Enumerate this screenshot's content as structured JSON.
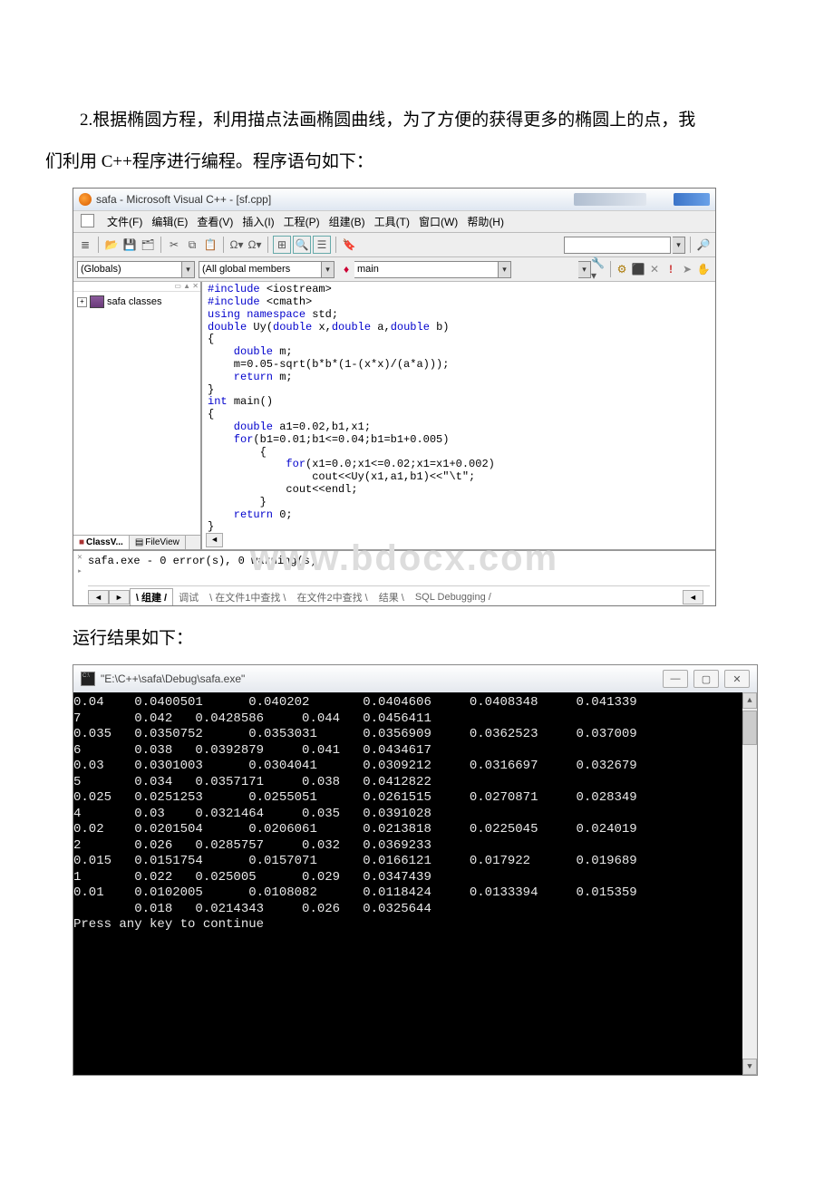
{
  "intro": {
    "line1": "2.根据椭圆方程，利用描点法画椭圆曲线，为了方便的获得更多的椭圆上的点，我",
    "line2": "们利用 C++程序进行编程。程序语句如下："
  },
  "ide": {
    "title": "safa - Microsoft Visual C++ - [sf.cpp]",
    "menu": {
      "file": "文件(F)",
      "edit": "编辑(E)",
      "view": "查看(V)",
      "insert": "插入(I)",
      "project": "工程(P)",
      "build": "组建(B)",
      "tools": "工具(T)",
      "window": "窗口(W)",
      "help": "帮助(H)"
    },
    "dropdown1": "(Globals)",
    "dropdown2": "(All global members",
    "dropdown3": "main",
    "tree": {
      "root": "safa classes"
    },
    "tabs": {
      "class": "ClassV...",
      "file": "FileView"
    },
    "output_text": "safa.exe - 0 error(s), 0 warning(s)",
    "output_tabs": {
      "build": "组建",
      "debug": "调试",
      "find1": "在文件1中查找",
      "find2": "在文件2中查找",
      "result": "结果",
      "sql": "SQL Debugging"
    },
    "code": {
      "l1a": "#include ",
      "l1b": "<iostream>",
      "l2a": "#include ",
      "l2b": "<cmath>",
      "l3a": "using namespace ",
      "l3b": "std;",
      "l4a": "double ",
      "l4b": "Uy(",
      "l4c": "double ",
      "l4d": "x,",
      "l4e": "double ",
      "l4f": "a,",
      "l4g": "double ",
      "l4h": "b)",
      "l5": "{",
      "l6a": "    double ",
      "l6b": "m;",
      "l7": "    m=0.05-sqrt(b*b*(1-(x*x)/(a*a)));",
      "l8a": "    return ",
      "l8b": "m;",
      "l9": "}",
      "l10a": "int ",
      "l10b": "main()",
      "l11": "{",
      "l12a": "    double ",
      "l12b": "a1=0.02,b1,x1;",
      "l13a": "    for",
      "l13b": "(b1=0.01;b1<=0.04;b1=b1+0.005)",
      "l14": "        {",
      "l15a": "            for",
      "l15b": "(x1=0.0;x1<=0.02;x1=x1+0.002)",
      "l16": "                cout<<Uy(x1,a1,b1)<<\"\\t\";",
      "l17": "            cout<<endl;",
      "l18": "        }",
      "l19a": "    return ",
      "l19b": "0;",
      "l20": "}"
    }
  },
  "watermark": "www.bdocx.com",
  "result_label": "运行结果如下：",
  "console": {
    "title": "\"E:\\C++\\safa\\Debug\\safa.exe\"",
    "rows": [
      [
        "0.04",
        "0.0400501",
        "0.040202",
        "0.0404606",
        "0.0408348",
        "0.041339"
      ],
      [
        "7",
        "0.042",
        "0.0428586",
        "0.044",
        "0.0456411",
        "",
        ""
      ],
      [
        "0.035",
        "0.0350752",
        "0.0353031",
        "0.0356909",
        "0.0362523",
        "0.037009"
      ],
      [
        "6",
        "0.038",
        "0.0392879",
        "0.041",
        "0.0434617",
        "",
        ""
      ],
      [
        "0.03",
        "0.0301003",
        "0.0304041",
        "0.0309212",
        "0.0316697",
        "0.032679"
      ],
      [
        "5",
        "0.034",
        "0.0357171",
        "0.038",
        "0.0412822",
        "",
        ""
      ],
      [
        "0.025",
        "0.0251253",
        "0.0255051",
        "0.0261515",
        "0.0270871",
        "0.028349"
      ],
      [
        "4",
        "0.03",
        "0.0321464",
        "0.035",
        "0.0391028",
        "",
        ""
      ],
      [
        "0.02",
        "0.0201504",
        "0.0206061",
        "0.0213818",
        "0.0225045",
        "0.024019"
      ],
      [
        "2",
        "0.026",
        "0.0285757",
        "0.032",
        "0.0369233",
        "",
        ""
      ],
      [
        "0.015",
        "0.0151754",
        "0.0157071",
        "0.0166121",
        "0.017922",
        "0.019689"
      ],
      [
        "1",
        "0.022",
        "0.025005",
        "0.029",
        "0.0347439",
        "",
        ""
      ],
      [
        "0.01",
        "0.0102005",
        "0.0108082",
        "0.0118424",
        "0.0133394",
        "0.015359"
      ],
      [
        "",
        "0.018",
        "0.0214343",
        "0.026",
        "0.0325644",
        "",
        ""
      ]
    ],
    "footer": "Press any key to continue"
  }
}
